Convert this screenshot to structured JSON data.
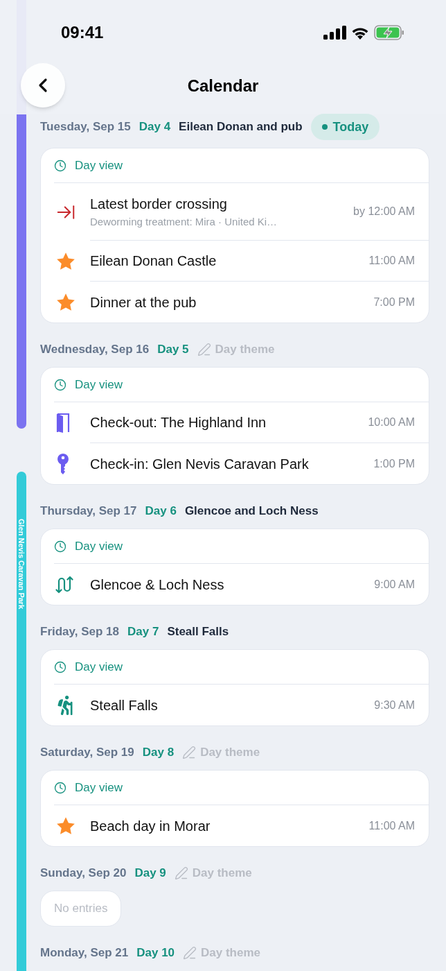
{
  "status_bar": {
    "time": "09:41"
  },
  "nav": {
    "title": "Calendar"
  },
  "stays": [
    {
      "color": "#7b73f0"
    },
    {
      "color": "#33cbd8",
      "label": "Glen Nevis Caravan Park"
    }
  ],
  "days": [
    {
      "date": "Tuesday, Sep 15",
      "day_number": "Day 4",
      "theme": "Eilean Donan and pub",
      "badge": "Today",
      "day_view": "Day view",
      "entries": [
        {
          "kind": "border",
          "title": "Latest border crossing",
          "subtitle": "Deworming treatment: Mira · United Ki…",
          "time": "by 12:00 AM"
        },
        {
          "kind": "star",
          "title": "Eilean Donan Castle",
          "time": "11:00 AM"
        },
        {
          "kind": "star",
          "title": "Dinner at the pub",
          "time": "7:00 PM"
        }
      ]
    },
    {
      "date": "Wednesday, Sep 16",
      "day_number": "Day 5",
      "theme_placeholder": "Day theme",
      "day_view": "Day view",
      "entries": [
        {
          "kind": "checkout",
          "title": "Check-out: The Highland Inn",
          "time": "10:00 AM"
        },
        {
          "kind": "checkin",
          "title": "Check-in: Glen Nevis Caravan Park",
          "time": "1:00 PM"
        }
      ]
    },
    {
      "date": "Thursday, Sep 17",
      "day_number": "Day 6",
      "theme": "Glencoe and Loch Ness",
      "day_view": "Day view",
      "entries": [
        {
          "kind": "route",
          "title": "Glencoe & Loch Ness",
          "time": "9:00 AM"
        }
      ]
    },
    {
      "date": "Friday, Sep 18",
      "day_number": "Day 7",
      "theme": "Steall Falls",
      "day_view": "Day view",
      "entries": [
        {
          "kind": "hike",
          "title": "Steall Falls",
          "time": "9:30 AM"
        }
      ]
    },
    {
      "date": "Saturday, Sep 19",
      "day_number": "Day 8",
      "theme_placeholder": "Day theme",
      "day_view": "Day view",
      "entries": [
        {
          "kind": "star",
          "title": "Beach day in Morar",
          "time": "11:00 AM"
        }
      ]
    },
    {
      "date": "Sunday, Sep 20",
      "day_number": "Day 9",
      "theme_placeholder": "Day theme",
      "empty_text": "No entries"
    },
    {
      "date": "Monday, Sep 21",
      "day_number": "Day 10",
      "theme_placeholder": "Day theme"
    }
  ]
}
